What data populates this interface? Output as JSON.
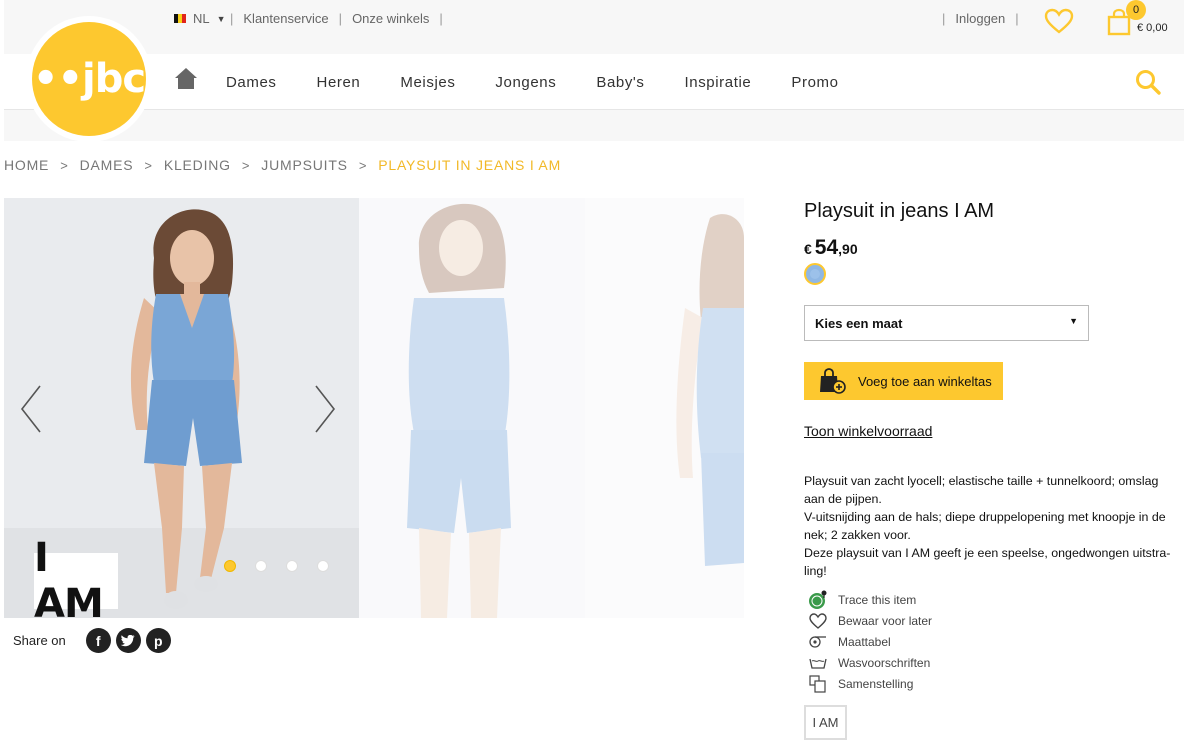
{
  "topbar": {
    "language": "NL",
    "links": [
      "Klantenservice",
      "Onze winkels"
    ],
    "login": "Inloggen",
    "cart_count": "0",
    "cart_total": "€ 0,00"
  },
  "nav": {
    "logo_text": "••jbc",
    "items": [
      "Dames",
      "Heren",
      "Meisjes",
      "Jongens",
      "Baby's",
      "Inspiratie",
      "Promo"
    ]
  },
  "breadcrumb": {
    "items": [
      "HOME",
      "DAMES",
      "KLEDING",
      "JUMPSUITS"
    ],
    "current": "PLAYSUIT IN JEANS I AM",
    "separator": ">"
  },
  "gallery": {
    "brand_badge": "I AM",
    "dot_count": 4,
    "active_dot": 0
  },
  "share": {
    "label": "Share on",
    "networks": [
      "f",
      "t",
      "p"
    ]
  },
  "product": {
    "title": "Playsuit in jeans I AM",
    "currency": "€",
    "price_main": "54",
    "price_cents": ",90",
    "swatch_color": "#8fb7e4",
    "size_placeholder": "Kies een maat",
    "add_to_cart": "Voeg toe aan winkeltas",
    "stock_link": "Toon winkelvoorraad",
    "description": [
      "Playsuit van zacht lyocell; elastische taille + tunnelkoord; omslag aan de pijpen.",
      "V-uitsnijding aan de hals; diepe druppelopening met knoopje in de nek; 2 zakken voor.",
      "Deze playsuit van I AM geeft je een speelse, ongedwongen uitstra-ling!"
    ],
    "features": [
      {
        "icon": "trace-icon",
        "label": "Trace this item"
      },
      {
        "icon": "heart-icon",
        "label": "Bewaar voor later"
      },
      {
        "icon": "measuring-tape-icon",
        "label": "Maattabel"
      },
      {
        "icon": "wash-icon",
        "label": "Wasvoorschriften"
      },
      {
        "icon": "composition-icon",
        "label": "Samenstelling"
      }
    ],
    "brand_tag": "I AM"
  },
  "colors": {
    "brand_yellow": "#fdc82f",
    "breadcrumb_current": "#f2b928"
  }
}
